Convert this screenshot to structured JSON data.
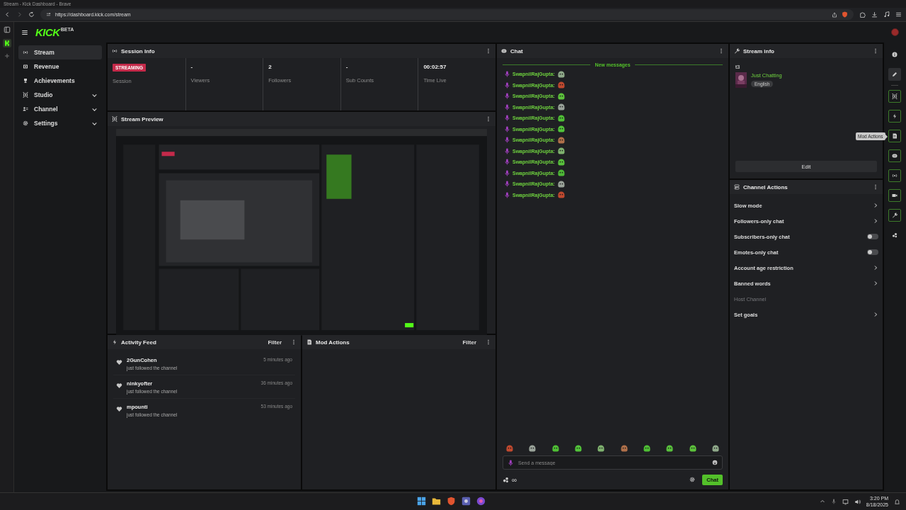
{
  "browser": {
    "title": "Stream - Kick Dashboard - Brave",
    "url": "https://dashboard.kick.com/stream"
  },
  "header": {
    "logo": "KICK",
    "logo_badge": "BETA"
  },
  "nav": [
    {
      "label": "Stream",
      "selected": true,
      "expandable": false
    },
    {
      "label": "Revenue",
      "selected": false,
      "expandable": false
    },
    {
      "label": "Achievements",
      "selected": false,
      "expandable": false
    },
    {
      "label": "Studio",
      "selected": false,
      "expandable": true
    },
    {
      "label": "Channel",
      "selected": false,
      "expandable": true
    },
    {
      "label": "Settings",
      "selected": false,
      "expandable": true
    }
  ],
  "session_info": {
    "title": "Session Info",
    "stats": [
      {
        "kind": "badge",
        "value": "STREAMING",
        "label": "Session"
      },
      {
        "kind": "text",
        "value": "-",
        "label": "Viewers"
      },
      {
        "kind": "text",
        "value": "2",
        "label": "Followers"
      },
      {
        "kind": "text",
        "value": "-",
        "label": "Sub Counts"
      },
      {
        "kind": "text",
        "value": "00:02:57",
        "label": "Time Live"
      }
    ]
  },
  "stream_preview": {
    "title": "Stream Preview"
  },
  "activity_feed": {
    "title": "Activity Feed",
    "filter": "Filter",
    "items": [
      {
        "user": "2GunCohen",
        "action": "just followed the channel",
        "time": "5 minutes ago"
      },
      {
        "user": "ninkyofter",
        "action": "just followed the channel",
        "time": "36 minutes ago"
      },
      {
        "user": "mpounti",
        "action": "just followed the channel",
        "time": "53 minutes ago"
      }
    ]
  },
  "mod_actions": {
    "title": "Mod Actions",
    "filter": "Filter"
  },
  "chat": {
    "title": "Chat",
    "divider": "New messages",
    "messages": [
      {
        "user": "SwapnilRajGupta:",
        "color": "#8fa98a"
      },
      {
        "user": "SwapnilRajGupta:",
        "color": "#c0492f"
      },
      {
        "user": "SwapnilRajGupta:",
        "color": "#5cc23b"
      },
      {
        "user": "SwapnilRajGupta:",
        "color": "#9aa39a"
      },
      {
        "user": "SwapnilRajGupta:",
        "color": "#4fbf35"
      },
      {
        "user": "SwapnilRajGupta:",
        "color": "#52c43a"
      },
      {
        "user": "SwapnilRajGupta:",
        "color": "#b0704a"
      },
      {
        "user": "SwapnilRajGupta:",
        "color": "#7fb26f"
      },
      {
        "user": "SwapnilRajGupta:",
        "color": "#58c03c"
      },
      {
        "user": "SwapnilRajGupta:",
        "color": "#4db836"
      },
      {
        "user": "SwapnilRajGupta:",
        "color": "#9aa39a"
      },
      {
        "user": "SwapnilRajGupta:",
        "color": "#c0492f"
      }
    ],
    "emotes": [
      {
        "color": "#c0492f"
      },
      {
        "color": "#9aa39a"
      },
      {
        "color": "#4fbf35"
      },
      {
        "color": "#52c43a"
      },
      {
        "color": "#7fb26f"
      },
      {
        "color": "#b0704a"
      },
      {
        "color": "#4fbf35"
      },
      {
        "color": "#58c03c"
      },
      {
        "color": "#5cc23b"
      },
      {
        "color": "#8fa98a"
      }
    ],
    "input": {
      "placeholder": "Send a message"
    },
    "points": "∞",
    "send": "Chat"
  },
  "stream_info": {
    "title": "Stream info",
    "stream_title": "t3",
    "category": "Just Chatting",
    "tags": [
      "English"
    ],
    "edit": "Edit"
  },
  "channel_actions": {
    "title": "Channel Actions",
    "items": [
      {
        "label": "Slow mode",
        "kind": "link",
        "disabled": false
      },
      {
        "label": "Followers-only chat",
        "kind": "link",
        "disabled": false
      },
      {
        "label": "Subscribers-only chat",
        "kind": "toggle",
        "disabled": false,
        "on": false
      },
      {
        "label": "Emotes-only chat",
        "kind": "toggle",
        "disabled": false,
        "on": false
      },
      {
        "label": "Account age restriction",
        "kind": "link",
        "disabled": false
      },
      {
        "label": "Banned words",
        "kind": "link",
        "disabled": false
      },
      {
        "label": "Host Channel",
        "kind": "link",
        "disabled": true
      },
      {
        "label": "Set goals",
        "kind": "link",
        "disabled": false
      }
    ]
  },
  "rail": [
    {
      "kind": "plain",
      "selected": false
    },
    {
      "kind": "plain",
      "selected": true
    },
    {
      "kind": "widget",
      "selected": false
    },
    {
      "kind": "widget",
      "selected": false
    },
    {
      "kind": "widget",
      "selected": false,
      "tooltip": "Mod Actions"
    },
    {
      "kind": "widget",
      "selected": false
    },
    {
      "kind": "widget",
      "selected": false
    },
    {
      "kind": "widget",
      "selected": false
    },
    {
      "kind": "widget",
      "selected": false
    },
    {
      "kind": "plain",
      "selected": false
    }
  ],
  "taskbar": {
    "time": "3:20 PM",
    "date": "8/18/2025"
  }
}
